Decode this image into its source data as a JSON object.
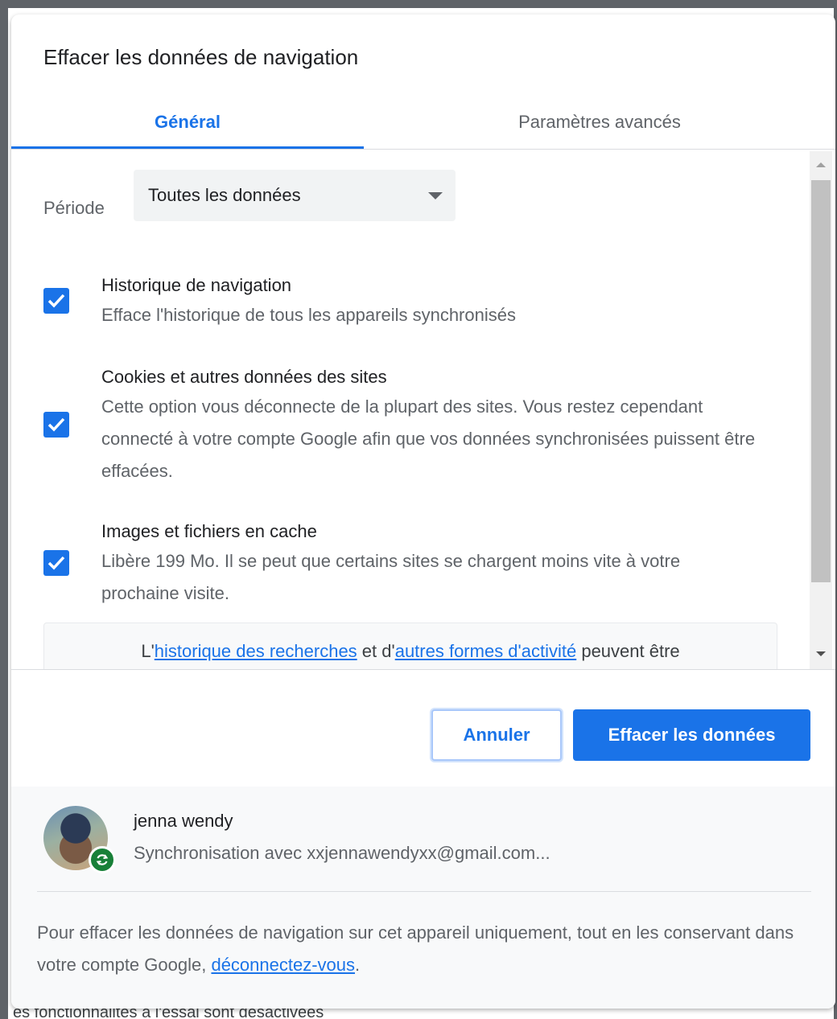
{
  "dialog": {
    "title": "Effacer les données de navigation"
  },
  "tabs": [
    {
      "label": "Général",
      "active": true
    },
    {
      "label": "Paramètres avancés",
      "active": false
    }
  ],
  "period": {
    "label": "Période",
    "value": "Toutes les données"
  },
  "options": [
    {
      "title": "Historique de navigation",
      "description": "Efface l'historique de tous les appareils synchronisés",
      "checked": true
    },
    {
      "title": "Cookies et autres données des sites",
      "description": "Cette option vous déconnecte de la plupart des sites. Vous restez cependant connecté à votre compte Google afin que vos données synchronisées puissent être effacées.",
      "checked": true
    },
    {
      "title": "Images et fichiers en cache",
      "description": "Libère 199 Mo. Il se peut que certains sites se chargent moins vite à votre prochaine visite.",
      "checked": true
    }
  ],
  "info": {
    "prefix": "L'",
    "link1": "historique des recherches",
    "middle": " et d'",
    "link2": "autres formes d'activité",
    "suffix": " peuvent être"
  },
  "buttons": {
    "cancel": "Annuler",
    "clear": "Effacer les données"
  },
  "account": {
    "name": "jenna wendy",
    "sync_text": "Synchronisation avec xxjennawendyxx@gmail.com..."
  },
  "footer": {
    "note_prefix": "Pour effacer les données de navigation sur cet appareil uniquement, tout en les conservant dans votre compte Google, ",
    "link": "déconnectez-vous",
    "note_suffix": "."
  },
  "backdrop": {
    "text": "es fonctionnalités à l'essai sont désactivées"
  },
  "colors": {
    "accent": "#1a73e8",
    "sync_badge": "#188038"
  }
}
